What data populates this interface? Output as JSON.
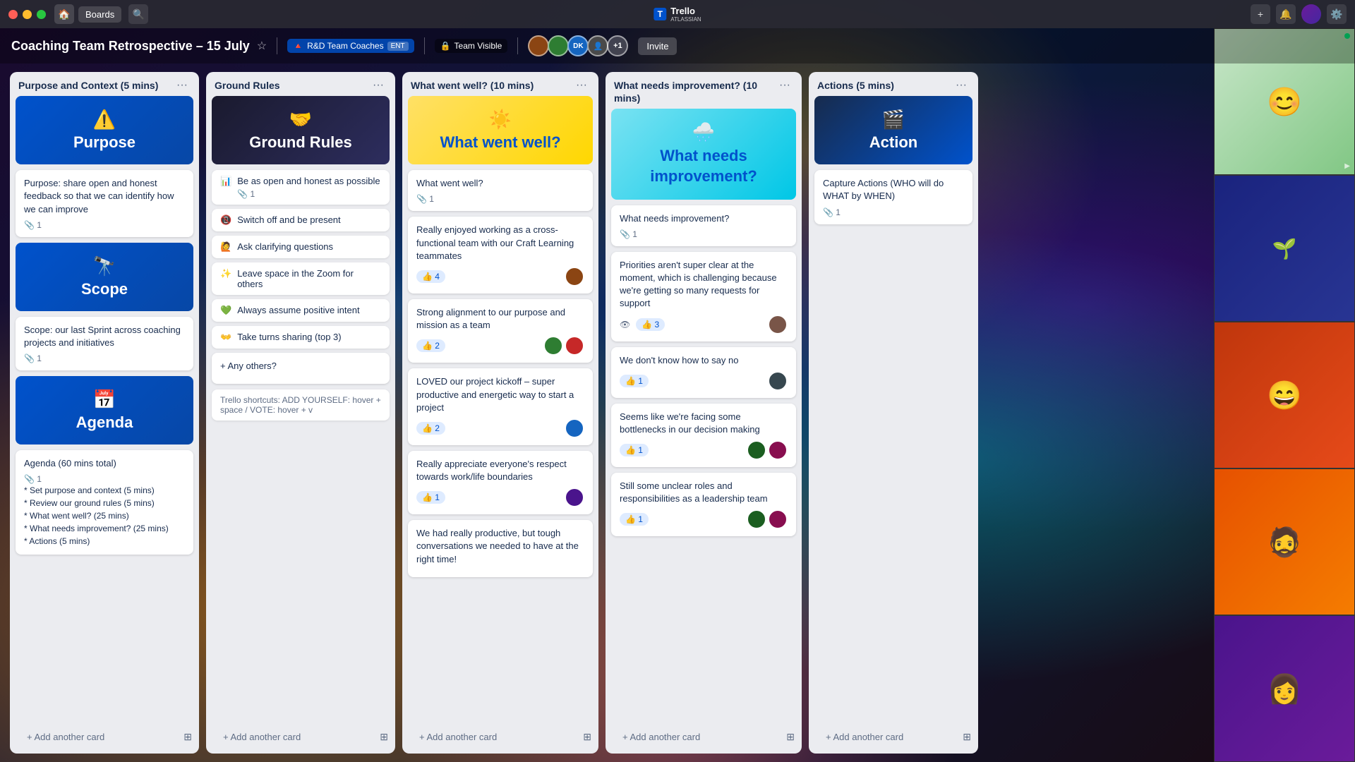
{
  "titlebar": {
    "home_icon": "🏠",
    "boards_label": "Boards",
    "search_icon": "🔍",
    "logo_name": "Trello",
    "logo_sub": "ATLASSIAN",
    "plus_icon": "+",
    "bell_icon": "🔔",
    "settings_icon": "⚙️"
  },
  "board": {
    "title": "Coaching Team Retrospective – 15 July",
    "star_icon": "⭐",
    "workspace_label": "R&D Team Coaches",
    "workspace_badge": "ENT",
    "visibility_label": "Team Visible",
    "invite_label": "Invite"
  },
  "columns": [
    {
      "id": "purpose",
      "title": "Purpose and Context (5 mins)",
      "cards": [
        {
          "type": "hero-blue",
          "emoji": "⚠️",
          "text": "Purpose"
        },
        {
          "type": "regular",
          "text": "Purpose: share open and honest feedback so that we can identify how we can improve",
          "attachment_count": "1"
        },
        {
          "type": "hero-blue",
          "emoji": "🔭",
          "text": "Scope"
        },
        {
          "type": "regular",
          "text": "Scope: our last Sprint across coaching projects and initiatives",
          "attachment_count": "1"
        },
        {
          "type": "hero-blue",
          "emoji": "📅",
          "text": "Agenda"
        },
        {
          "type": "agenda",
          "text": "Agenda (60 mins total)",
          "attachment_count": "1",
          "items": [
            "* Set purpose and context (5 mins)",
            "* Review our ground rules (5 mins)",
            "* What went well? (25 mins)",
            "* What needs improvement? (25 mins)",
            "* Actions (5 mins)"
          ]
        }
      ],
      "add_card_label": "+ Add another card"
    },
    {
      "id": "ground-rules",
      "title": "Ground Rules",
      "cards": [
        {
          "type": "hero-dark",
          "emoji": "🤝",
          "text": "Ground Rules"
        },
        {
          "type": "ground-rule",
          "emoji": "📊",
          "text": "Be as open and honest as possible",
          "attachment_count": "1"
        },
        {
          "type": "ground-rule",
          "emoji": "📵",
          "text": "Switch off and be present"
        },
        {
          "type": "ground-rule",
          "emoji": "🙋",
          "text": "Ask clarifying questions"
        },
        {
          "type": "ground-rule",
          "emoji": "✨",
          "text": "Leave space in the Zoom for others"
        },
        {
          "type": "ground-rule",
          "emoji": "💚",
          "text": "Always assume positive intent"
        },
        {
          "type": "ground-rule",
          "emoji": "👐",
          "text": "Take turns sharing (top 3)"
        },
        {
          "type": "any-others",
          "text": "+ Any others?"
        },
        {
          "type": "shortcuts",
          "text": "Trello shortcuts: ADD YOURSELF: hover + space / VOTE: hover + v"
        }
      ],
      "add_card_label": "+ Add another card"
    },
    {
      "id": "went-well",
      "title": "What went well? (10 mins)",
      "cards": [
        {
          "type": "hero-yellow",
          "emoji": "☀️",
          "text": "What went well?"
        },
        {
          "type": "regular",
          "text": "What went well?",
          "attachment_count": "1"
        },
        {
          "type": "regular",
          "text": "Really enjoyed working as a cross-functional team with our Craft Learning teammates",
          "votes": "4",
          "avatar_colors": [
            "#8B4513"
          ]
        },
        {
          "type": "regular",
          "text": "Strong alignment to our purpose and mission as a team",
          "votes": "2",
          "avatar_colors": [
            "#2e7d32",
            "#c62828"
          ]
        },
        {
          "type": "regular",
          "text": "LOVED our project kickoff – super productive and energetic way to start a project",
          "votes": "2",
          "avatar_colors": [
            "#1565c0"
          ]
        },
        {
          "type": "regular",
          "text": "Really appreciate everyone's respect towards work/life boundaries",
          "votes": "1",
          "avatar_colors": [
            "#4a148c"
          ]
        },
        {
          "type": "regular",
          "text": "We had really productive, but tough conversations we needed to have at the right time!"
        }
      ],
      "add_card_label": "+ Add another card"
    },
    {
      "id": "needs-improvement",
      "title": "What needs improvement? (10 mins)",
      "cards": [
        {
          "type": "hero-cyan",
          "emoji": "🌧️",
          "text": "What needs improvement?"
        },
        {
          "type": "regular",
          "text": "What needs improvement?",
          "attachment_count": "1"
        },
        {
          "type": "regular",
          "text": "Priorities aren't super clear at the moment, which is challenging because we're getting so many requests for support",
          "eye": true,
          "votes": "3",
          "avatar_colors": [
            "#795548"
          ]
        },
        {
          "type": "regular",
          "text": "We don't know how to say no",
          "votes": "1",
          "avatar_colors": [
            "#37474f"
          ]
        },
        {
          "type": "regular",
          "text": "Seems like we're facing some bottlenecks in our decision making",
          "votes": "1",
          "avatar_colors": [
            "#1b5e20",
            "#880e4f"
          ]
        },
        {
          "type": "regular",
          "text": "Still some unclear roles and responsibilities as a leadership team",
          "votes": "1",
          "avatar_colors": [
            "#1b5e20",
            "#880e4f"
          ]
        }
      ],
      "add_card_label": "+ Add another card"
    },
    {
      "id": "actions",
      "title": "Actions (5 mins)",
      "cards": [
        {
          "type": "hero-dark2",
          "emoji": "🎬",
          "text": "Action"
        },
        {
          "type": "regular",
          "text": "Capture Actions (WHO will do WHAT by WHEN)",
          "attachment_count": "1"
        }
      ],
      "add_card_label": "+ Add another card"
    }
  ],
  "video_cells": [
    {
      "bg": "v1",
      "has_dot": true,
      "has_arrow": true
    },
    {
      "bg": "v2",
      "has_dot": false,
      "has_arrow": false
    },
    {
      "bg": "v3",
      "has_dot": false,
      "has_arrow": false
    },
    {
      "bg": "v4",
      "has_dot": false,
      "has_arrow": false
    },
    {
      "bg": "v5",
      "has_dot": false,
      "has_arrow": false
    }
  ]
}
